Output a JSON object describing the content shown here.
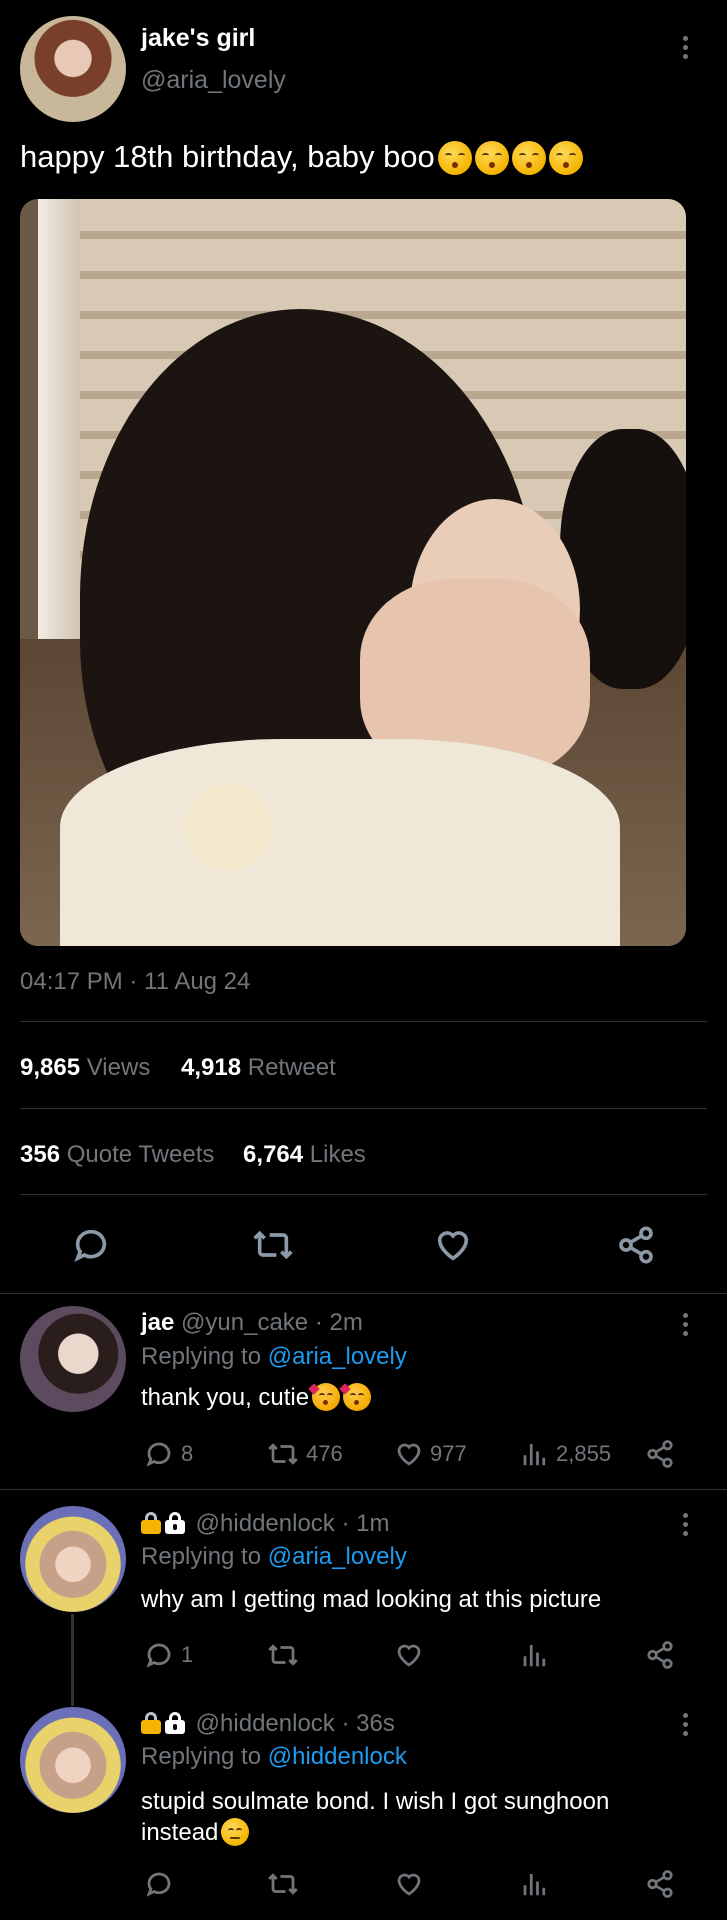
{
  "tweet": {
    "display_name": "jake's girl",
    "handle": "@aria_lovely",
    "text": "happy 18th birthday, baby boo",
    "timestamp": "04:17 PM · 11 Aug 24",
    "stats": {
      "views_value": "9,865",
      "views_label": "Views",
      "retweets_value": "4,918",
      "retweets_label": "Retweet",
      "quotes_value": "356",
      "quotes_label": "Quote Tweets",
      "likes_value": "6,764",
      "likes_label": "Likes"
    }
  },
  "replies": [
    {
      "display_name": "jae",
      "handle": "@yun_cake",
      "time": "· 2m",
      "replying_prefix": "Replying to",
      "replying_to": "@aria_lovely",
      "text": "thank you, cutie",
      "counts": {
        "replies": "8",
        "retweets": "476",
        "likes": "977",
        "views": "2,855"
      }
    },
    {
      "handle": "@hiddenlock",
      "time": "· 1m",
      "replying_prefix": "Replying to",
      "replying_to": "@aria_lovely",
      "text": "why am I getting mad looking at this picture",
      "counts": {
        "replies": "1"
      }
    },
    {
      "handle": "@hiddenlock",
      "time": "· 36s",
      "replying_prefix": "Replying to",
      "replying_to": "@hiddenlock",
      "text": "stupid soulmate bond. I wish I got sunghoon instead"
    }
  ],
  "icons": {
    "reply": "speech-bubble-icon",
    "retweet": "retweet-arrows-icon",
    "like": "heart-icon",
    "views": "bar-chart-icon",
    "share": "share-nodes-icon",
    "more": "vertical-ellipsis-icon"
  },
  "colors": {
    "background": "#000000",
    "muted": "#71767b",
    "link": "#1d9bf0",
    "divider": "#2f3336"
  }
}
